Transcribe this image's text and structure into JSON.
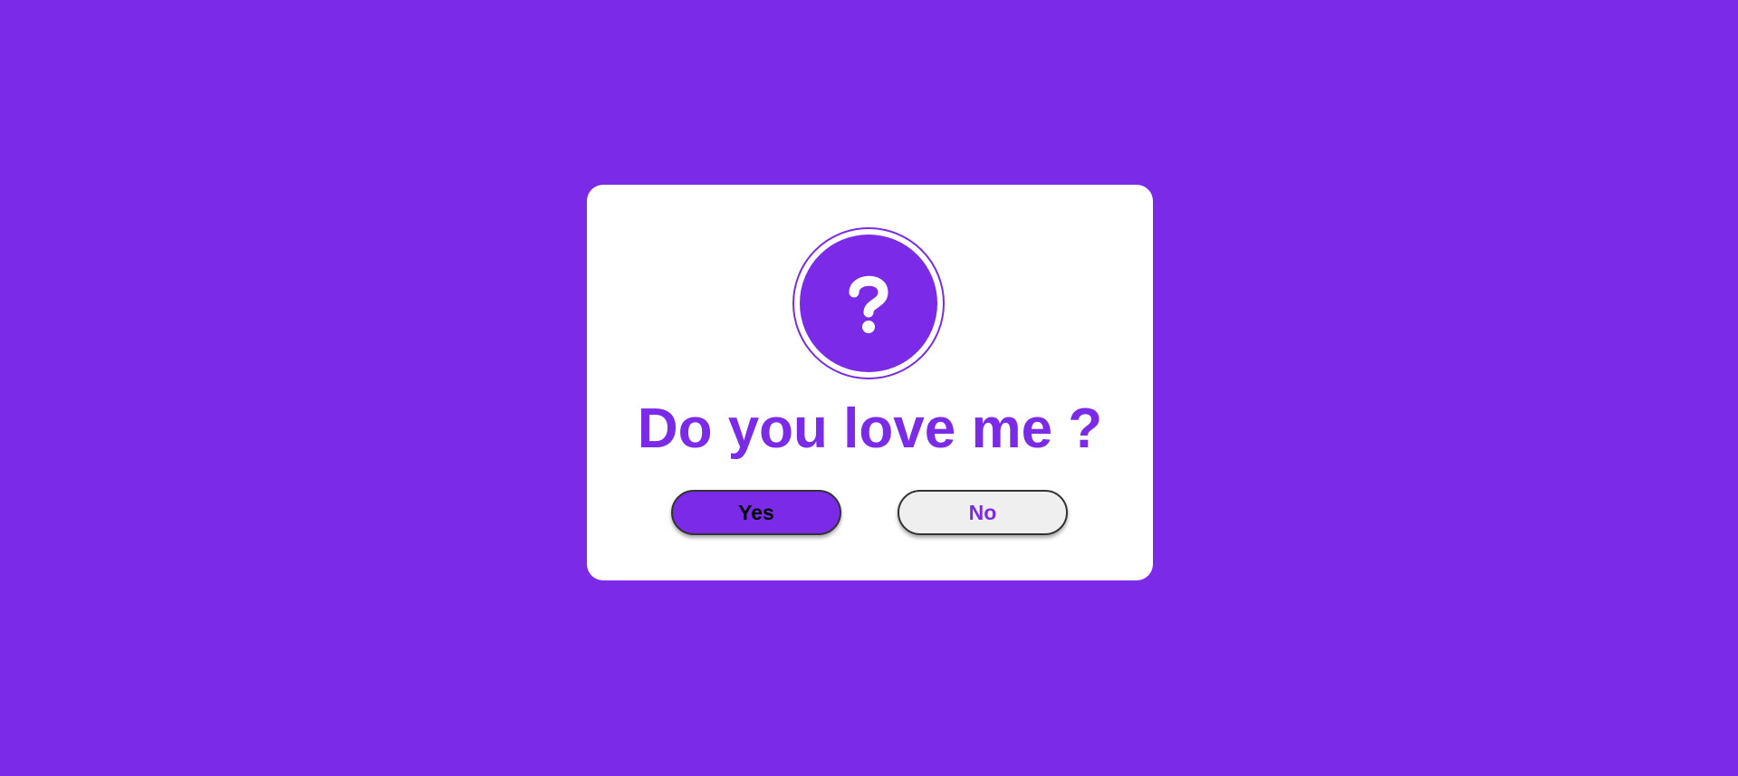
{
  "dialog": {
    "icon": "question-mark-icon",
    "question": "Do you love me ?",
    "yes_label": "Yes",
    "no_label": "No"
  },
  "colors": {
    "accent": "#7b2be8",
    "card_background": "#ffffff",
    "no_button_background": "#efefef",
    "yes_text": "#000000"
  }
}
